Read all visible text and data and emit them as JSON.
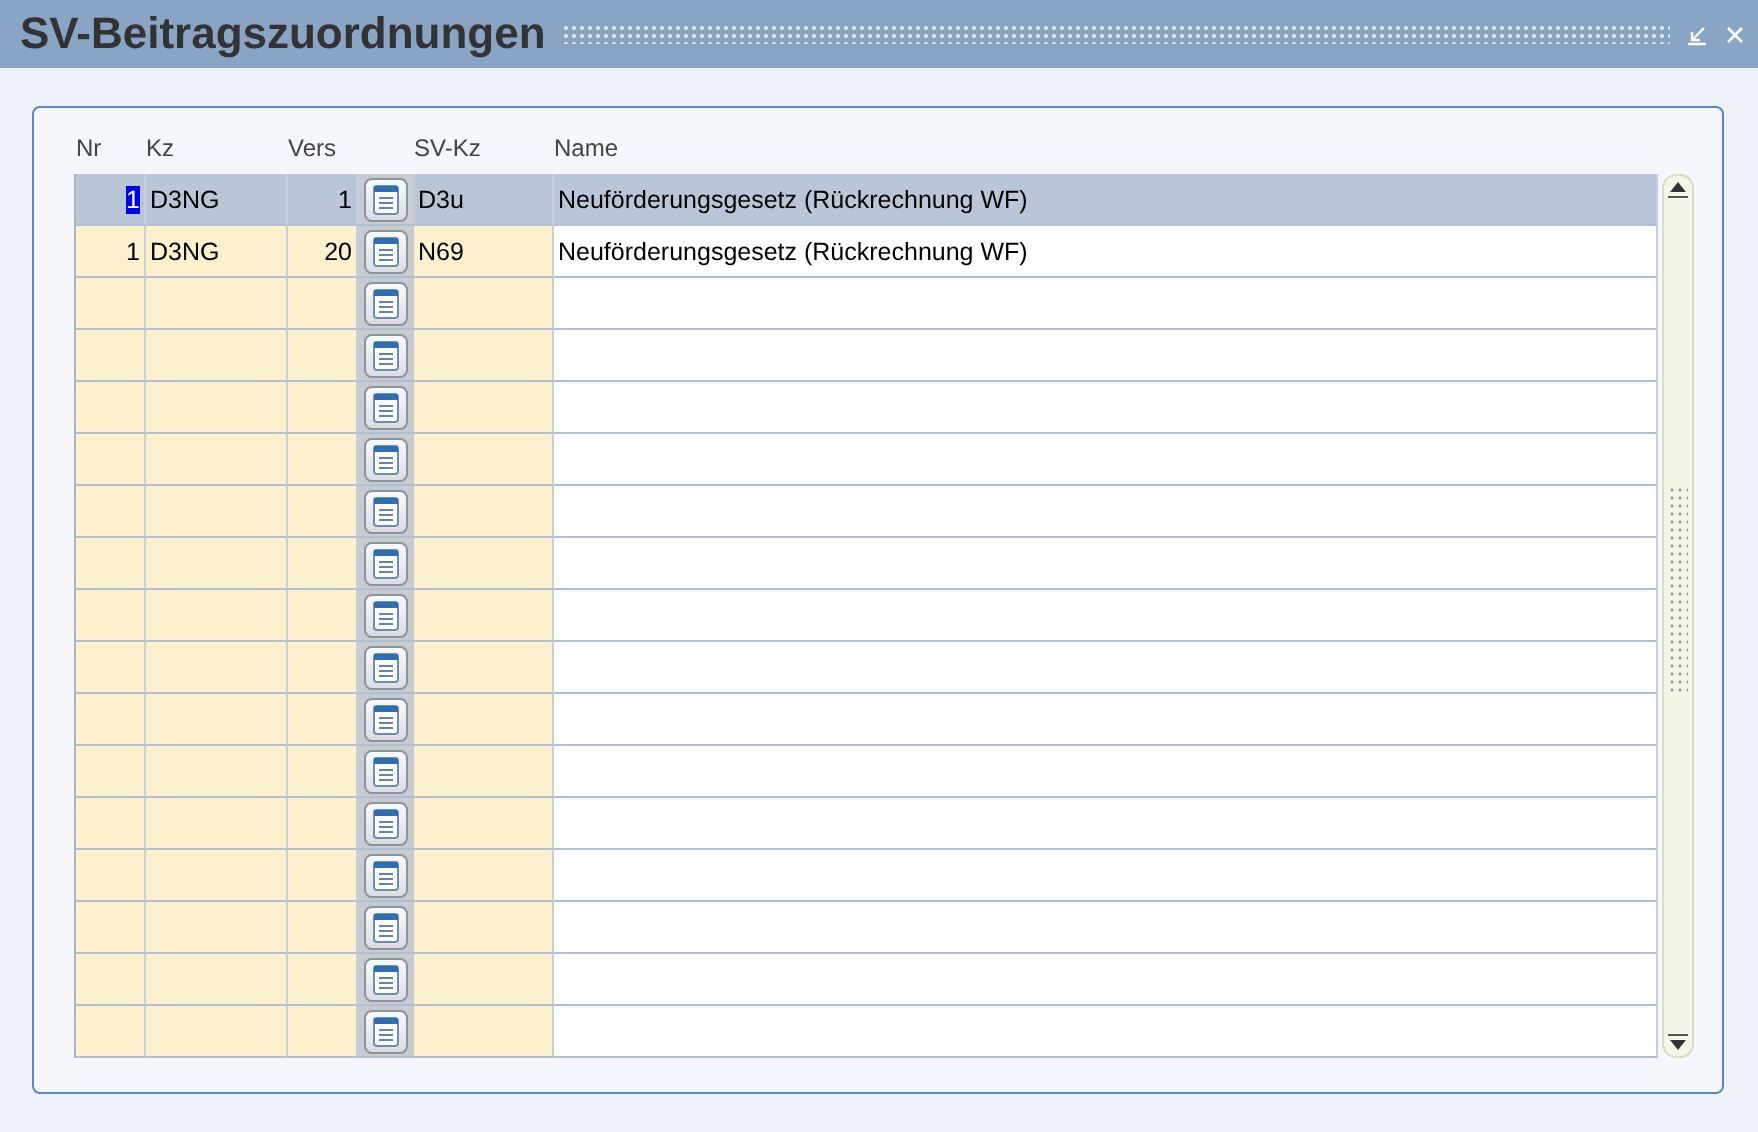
{
  "window": {
    "title": "SV-Beitragszuordnungen"
  },
  "table": {
    "columns": [
      "Nr",
      "Kz",
      "Vers",
      "SV-Kz",
      "Name"
    ],
    "rows": [
      {
        "selected": true,
        "nr": "1",
        "kz": "D3NG",
        "vers": "1",
        "sv_kz": "D3u",
        "name": "Neuförderungsgesetz (Rückrechnung WF)"
      },
      {
        "selected": false,
        "nr": "1",
        "kz": "D3NG",
        "vers": "20",
        "sv_kz": "N69",
        "name": "Neuförderungsgesetz (Rückrechnung WF)"
      },
      {
        "selected": false
      },
      {
        "selected": false
      },
      {
        "selected": false
      },
      {
        "selected": false
      },
      {
        "selected": false
      },
      {
        "selected": false
      },
      {
        "selected": false
      },
      {
        "selected": false
      },
      {
        "selected": false
      },
      {
        "selected": false
      },
      {
        "selected": false
      },
      {
        "selected": false
      },
      {
        "selected": false
      },
      {
        "selected": false
      },
      {
        "selected": false
      }
    ]
  }
}
